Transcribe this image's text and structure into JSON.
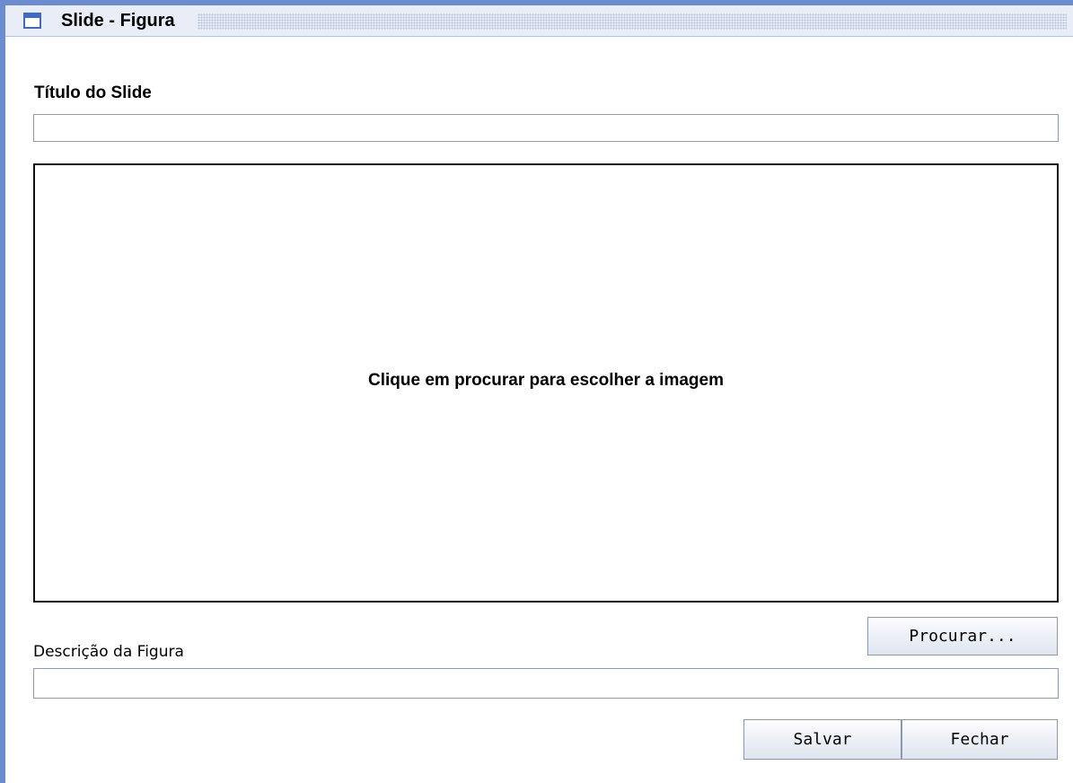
{
  "window": {
    "title": "Slide - Figura",
    "icon": "window-icon"
  },
  "form": {
    "slide_title_label": "Título do Slide",
    "slide_title_value": "",
    "image_hint": "Clique em procurar para escolher a imagem",
    "description_label": "Descrição da Figura",
    "description_value": ""
  },
  "buttons": {
    "browse": "Procurar...",
    "save": "Salvar",
    "close": "Fechar"
  },
  "colors": {
    "frame_border": "#6c8ccf",
    "icon_accent": "#3e6cc4"
  }
}
